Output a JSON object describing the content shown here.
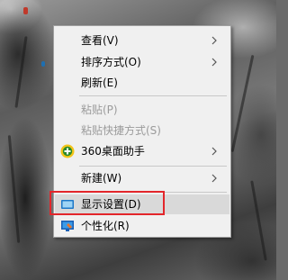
{
  "menu": {
    "items": [
      {
        "label": "查看(V)",
        "submenu": true,
        "disabled": false
      },
      {
        "label": "排序方式(O)",
        "submenu": true,
        "disabled": false
      },
      {
        "label": "刷新(E)",
        "submenu": false,
        "disabled": false
      },
      {
        "label": "粘贴(P)",
        "submenu": false,
        "disabled": true
      },
      {
        "label": "粘贴快捷方式(S)",
        "submenu": false,
        "disabled": true
      },
      {
        "label": "360桌面助手",
        "submenu": true,
        "disabled": false,
        "icon": "360-assistant-icon"
      },
      {
        "label": "新建(W)",
        "submenu": true,
        "disabled": false
      },
      {
        "label": "显示设置(D)",
        "submenu": false,
        "disabled": false,
        "icon": "display-settings-icon",
        "highlighted": true
      },
      {
        "label": "个性化(R)",
        "submenu": false,
        "disabled": false,
        "icon": "personalize-icon"
      }
    ]
  },
  "colors": {
    "menu_bg": "#f0f0f0",
    "hover_bg": "#d9d9d9",
    "highlight_border": "#e3262b",
    "disabled_text": "#9b9b9b"
  }
}
